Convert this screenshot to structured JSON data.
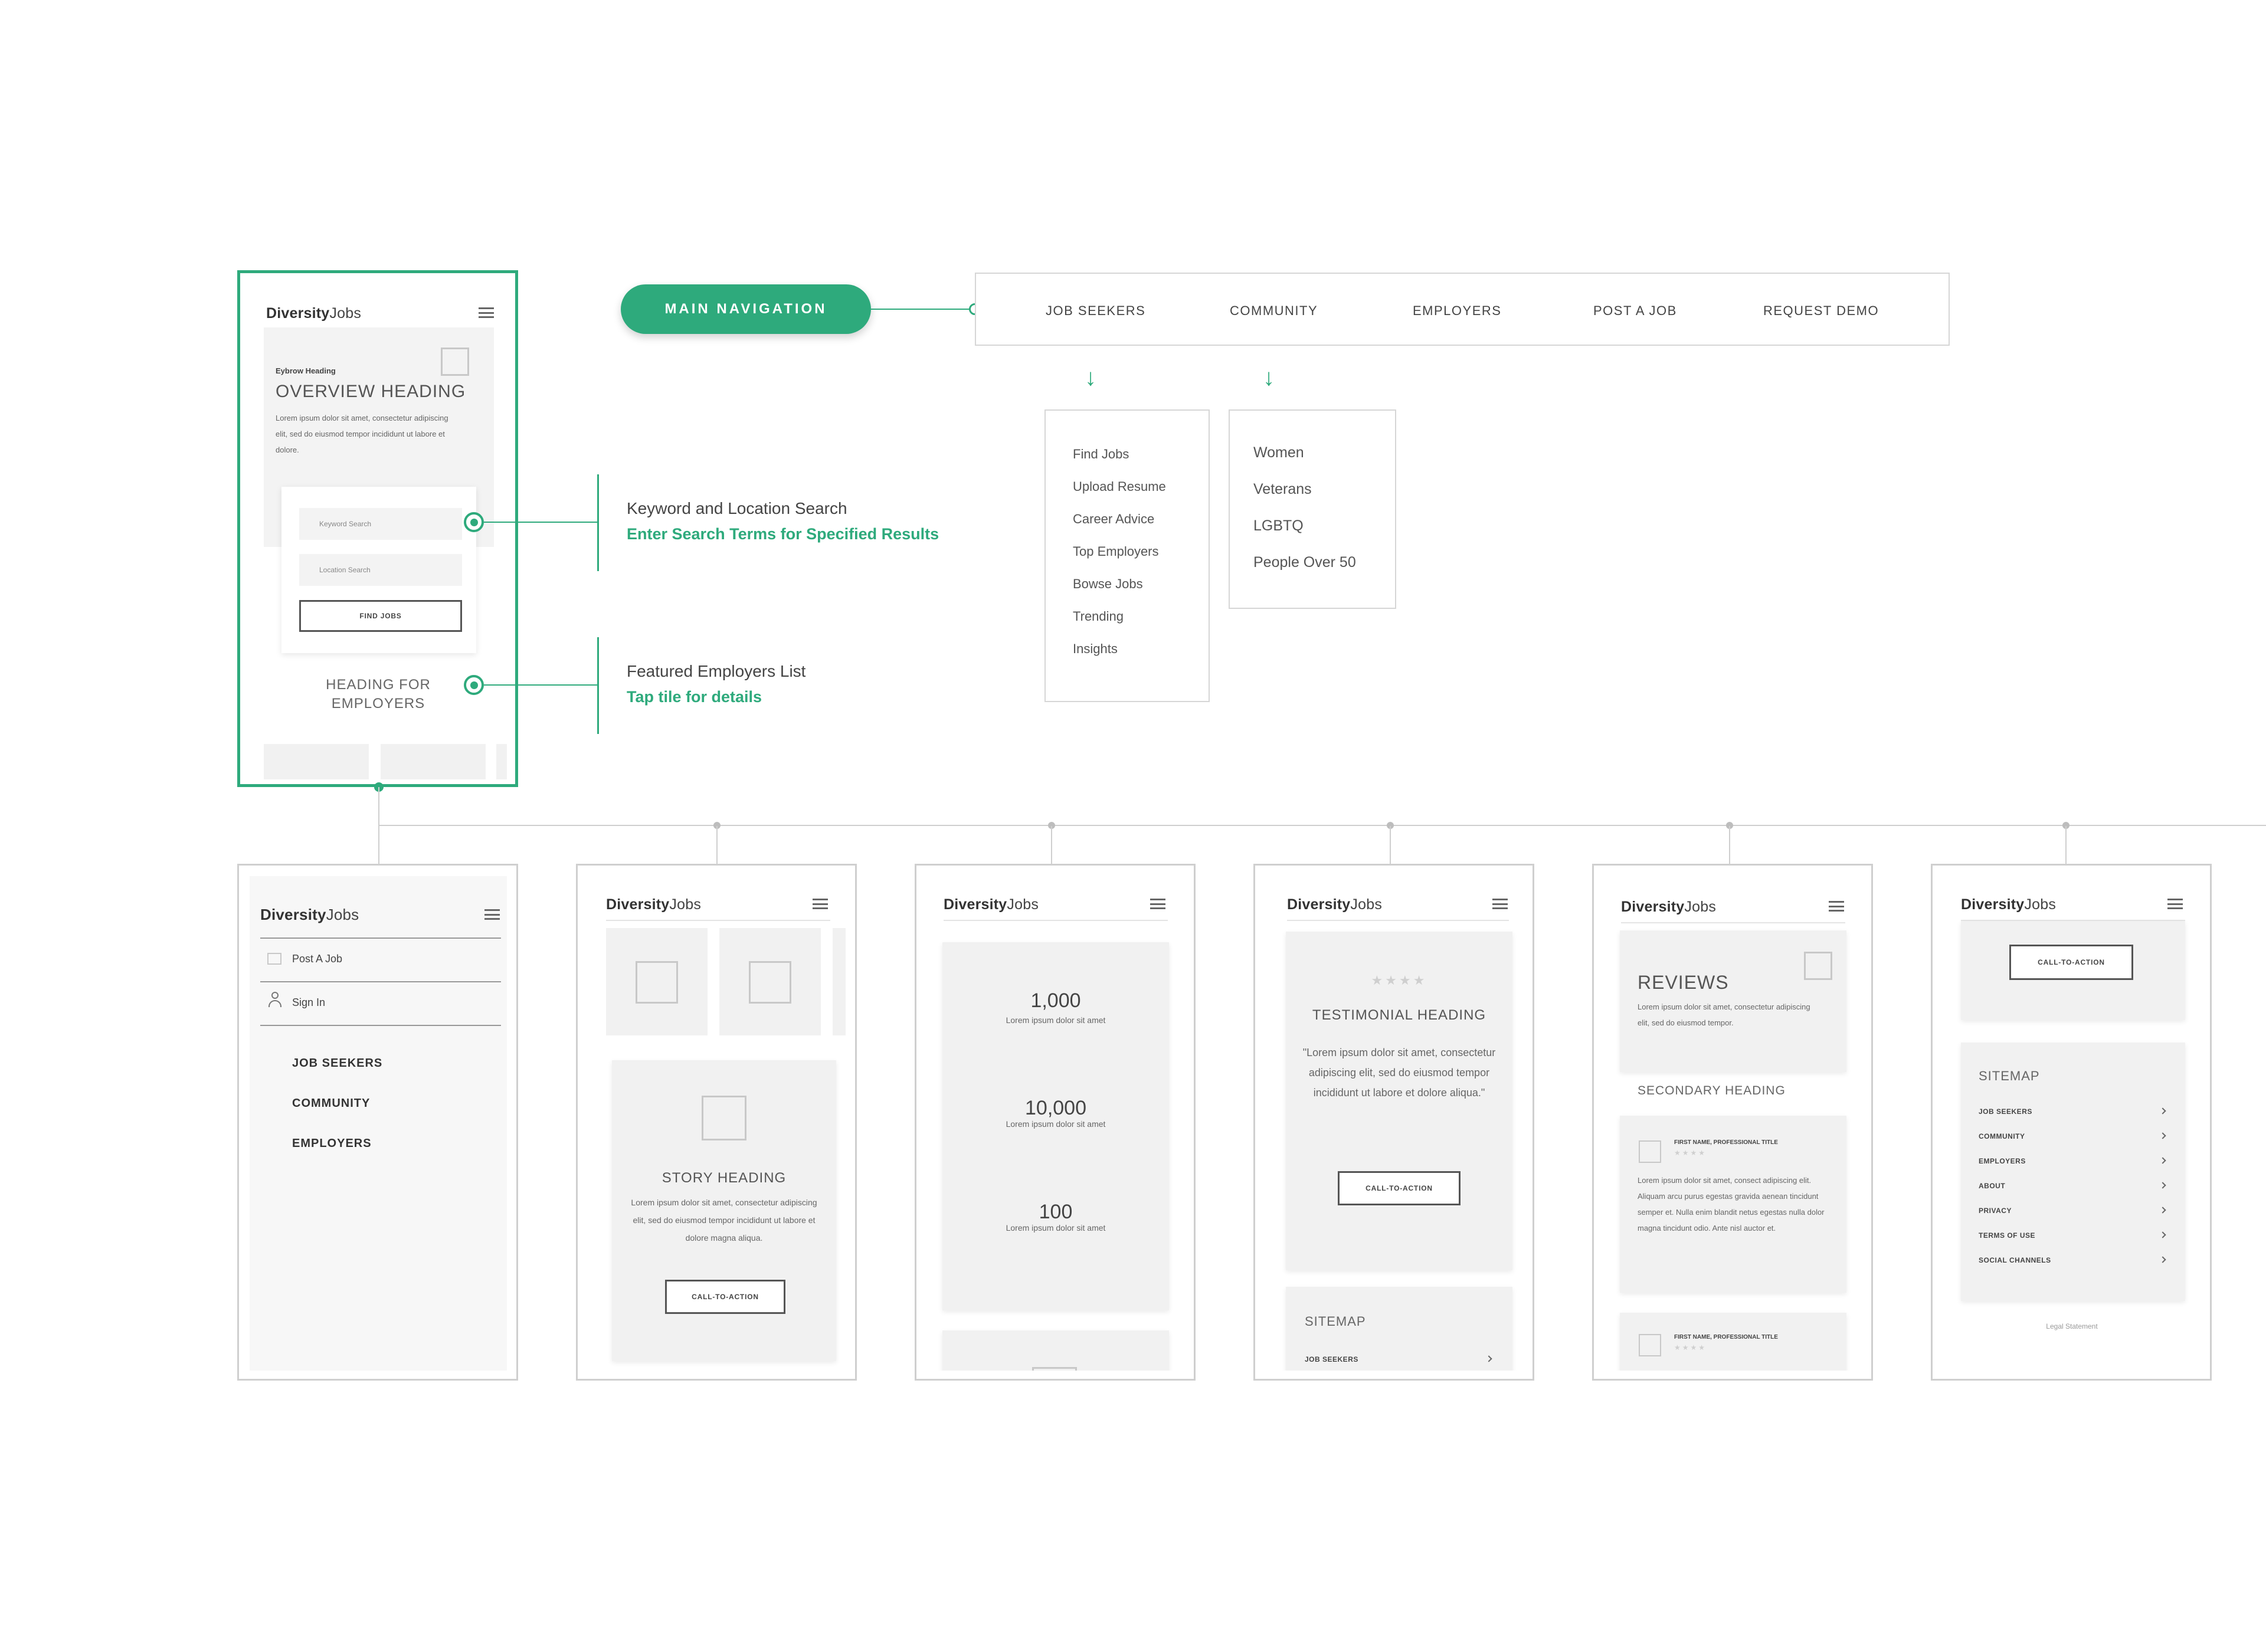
{
  "brand": {
    "logo_bold": "Diversity",
    "logo_light": "Jobs"
  },
  "colors": {
    "accent": "#2eaa7c",
    "wire": "#cfcfcf",
    "screen_bg": "#f7f7f7"
  },
  "main_nav": {
    "pill_label": "MAIN NAVIGATION",
    "items": [
      "JOB SEEKERS",
      "COMMUNITY",
      "EMPLOYERS",
      "POST A JOB",
      "REQUEST DEMO"
    ]
  },
  "dropdowns": {
    "job_seekers": [
      "Find Jobs",
      "Upload Resume",
      "Career Advice",
      "Top Employers",
      "Bowse Jobs",
      "Trending",
      "Insights"
    ],
    "community": [
      "Women",
      "Veterans",
      "LGBTQ",
      "People Over 50"
    ]
  },
  "annotations": {
    "search": {
      "title": "Keyword and Location Search",
      "subtitle": "Enter Search Terms for Specified Results"
    },
    "employers": {
      "title": "Featured Employers List",
      "subtitle": "Tap tile for details"
    }
  },
  "hero_phone": {
    "eyebrow": "Eybrow Heading",
    "heading": "OVERVIEW HEADING",
    "body": "Lorem ipsum dolor sit amet, consectetur adipiscing elit, sed do eiusmod tempor incididunt ut labore et dolore.",
    "keyword_placeholder": "Keyword Search",
    "location_placeholder": "Location Search",
    "find_button": "FIND JOBS",
    "employers_heading": "HEADING FOR EMPLOYERS"
  },
  "menu_phone": {
    "post_job": "Post A Job",
    "sign_in": "Sign In",
    "items": [
      "JOB SEEKERS",
      "COMMUNITY",
      "EMPLOYERS"
    ]
  },
  "story_phone": {
    "heading": "STORY HEADING",
    "body": "Lorem ipsum dolor sit amet, consectetur adipiscing elit, sed do eiusmod tempor incididunt ut labore et dolore magna aliqua.",
    "cta": "CALL-TO-ACTION"
  },
  "stats_phone": {
    "stats": [
      {
        "value": "1,000",
        "caption": "Lorem ipsum dolor sit amet"
      },
      {
        "value": "10,000",
        "caption": "Lorem ipsum dolor sit amet"
      },
      {
        "value": "100",
        "caption": "Lorem ipsum dolor sit amet"
      }
    ]
  },
  "testimonial_phone": {
    "stars": "★★★★",
    "heading": "TESTIMONIAL HEADING",
    "quote": "\"Lorem ipsum dolor sit amet, consectetur adipiscing elit, sed do eiusmod tempor incididunt ut labore et dolore aliqua.\"",
    "cta": "CALL-TO-ACTION",
    "sitemap_heading": "SITEMAP",
    "sitemap_first": "JOB SEEKERS"
  },
  "reviews_phone": {
    "heading": "REVIEWS",
    "body": "Lorem ipsum dolor sit amet, consectetur adipiscing elit, sed do eiusmod tempor.",
    "secondary": "SECONDARY HEADING",
    "reviewer": "FIRST NAME, PROFESSIONAL TITLE",
    "stars": "★★★★",
    "review_body": "Lorem ipsum dolor sit amet, consect adipiscing elit. Aliquam arcu purus egestas gravida aenean tincidunt semper et. Nulla enim blandit netus egestas nulla dolor magna tincidunt odio. Ante nisl auctor et."
  },
  "footer_phone": {
    "cta": "CALL-TO-ACTION",
    "sitemap_heading": "SITEMAP",
    "sitemap_items": [
      "JOB SEEKERS",
      "COMMUNITY",
      "EMPLOYERS",
      "ABOUT",
      "PRIVACY",
      "TERMS OF USE",
      "SOCIAL CHANNELS"
    ],
    "legal": "Legal Statement"
  }
}
